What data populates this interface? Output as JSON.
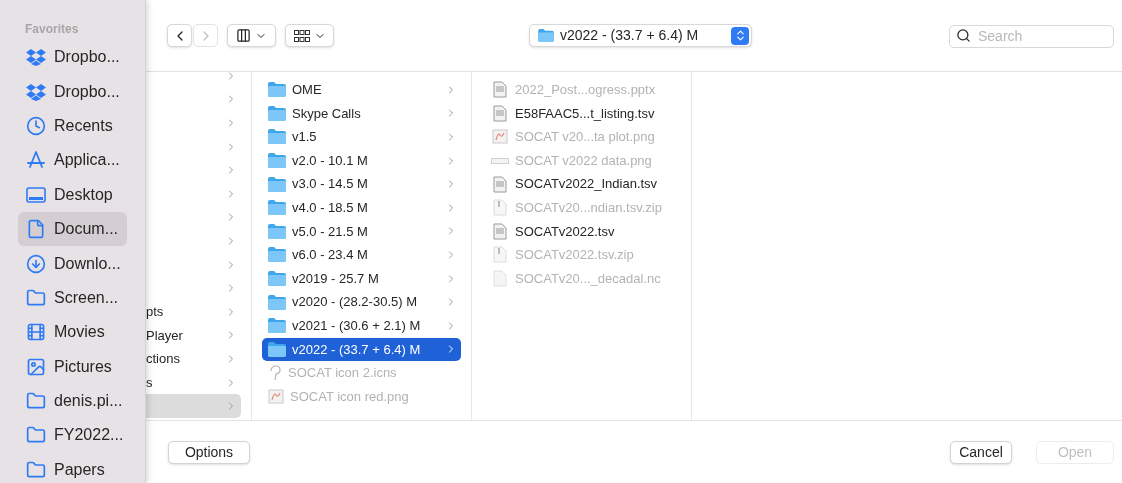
{
  "sidebar": {
    "heading": "Favorites",
    "items": [
      {
        "label": "Dropbo...",
        "kind": "dropbox",
        "selected": false
      },
      {
        "label": "Dropbo...",
        "kind": "dropbox",
        "selected": false
      },
      {
        "label": "Recents",
        "kind": "clock",
        "selected": false
      },
      {
        "label": "Applica...",
        "kind": "apps",
        "selected": false
      },
      {
        "label": "Desktop",
        "kind": "desktop",
        "selected": false
      },
      {
        "label": "Docum...",
        "kind": "document",
        "selected": true
      },
      {
        "label": "Downlo...",
        "kind": "download",
        "selected": false
      },
      {
        "label": "Screen...",
        "kind": "folder",
        "selected": false
      },
      {
        "label": "Movies",
        "kind": "film",
        "selected": false
      },
      {
        "label": "Pictures",
        "kind": "photo",
        "selected": false
      },
      {
        "label": "denis.pi...",
        "kind": "folder",
        "selected": false
      },
      {
        "label": "FY2022...",
        "kind": "folder",
        "selected": false
      },
      {
        "label": "Papers",
        "kind": "folder",
        "selected": false
      }
    ]
  },
  "toolbar": {
    "path": "v2022 - (33.7 + 6.4) M",
    "search": {
      "placeholder": "Search"
    }
  },
  "column_1": [
    {
      "selected": false
    },
    {
      "selected": false
    },
    {
      "selected": false
    },
    {
      "selected": false
    },
    {
      "selected": false
    },
    {
      "selected": false
    },
    {
      "selected": false
    },
    {
      "selected": false
    },
    {
      "selected": false
    },
    {
      "selected": false
    },
    {
      "label": "pts",
      "selected": false
    },
    {
      "label": "Player",
      "selected": false
    },
    {
      "label": "ctions",
      "selected": false
    },
    {
      "label": "s",
      "selected": false
    },
    {
      "selected": true
    }
  ],
  "column_2": [
    {
      "label": "OME",
      "kind": "folder",
      "selected": false,
      "disabled": false
    },
    {
      "label": "Skype Calls",
      "kind": "folder",
      "selected": false,
      "disabled": false
    },
    {
      "label": "v1.5",
      "kind": "folder",
      "selected": false,
      "disabled": false
    },
    {
      "label": "v2.0 - 10.1 M",
      "kind": "folder",
      "selected": false,
      "disabled": false
    },
    {
      "label": "v3.0 - 14.5 M",
      "kind": "folder",
      "selected": false,
      "disabled": false
    },
    {
      "label": "v4.0 - 18.5 M",
      "kind": "folder",
      "selected": false,
      "disabled": false
    },
    {
      "label": "v5.0 - 21.5 M",
      "kind": "folder",
      "selected": false,
      "disabled": false
    },
    {
      "label": "v6.0 - 23.4 M",
      "kind": "folder",
      "selected": false,
      "disabled": false
    },
    {
      "label": "v2019 - 25.7 M",
      "kind": "folder",
      "selected": false,
      "disabled": false
    },
    {
      "label": "v2020 - (28.2-30.5) M",
      "kind": "folder",
      "selected": false,
      "disabled": false
    },
    {
      "label": "v2021 - (30.6 + 2.1) M",
      "kind": "folder",
      "selected": false,
      "disabled": false
    },
    {
      "label": "v2022 - (33.7 + 6.4) M",
      "kind": "folder",
      "selected": true,
      "disabled": false
    },
    {
      "label": "SOCAT icon 2.icns",
      "kind": "icns",
      "selected": false,
      "disabled": true
    },
    {
      "label": "SOCAT icon red.png",
      "kind": "image",
      "selected": false,
      "disabled": true
    }
  ],
  "column_3": [
    {
      "label": "2022_Post...ogress.pptx",
      "kind": "document",
      "disabled": true
    },
    {
      "label": "E58FAAC5...t_listing.tsv",
      "kind": "document",
      "disabled": false
    },
    {
      "label": "SOCAT v20...ta plot.png",
      "kind": "image",
      "disabled": true
    },
    {
      "label": "SOCAT v2022 data.png",
      "kind": "strip",
      "disabled": true
    },
    {
      "label": "SOCATv2022_Indian.tsv",
      "kind": "document",
      "disabled": false
    },
    {
      "label": "SOCATv20...ndian.tsv.zip",
      "kind": "zip",
      "disabled": true
    },
    {
      "label": "SOCATv2022.tsv",
      "kind": "document",
      "disabled": false
    },
    {
      "label": "SOCATv2022.tsv.zip",
      "kind": "zip",
      "disabled": true
    },
    {
      "label": "SOCATv20..._decadal.nc",
      "kind": "plain",
      "disabled": true
    }
  ],
  "buttons": [
    {
      "label": "Options",
      "disabled": false
    },
    {
      "label": "Cancel",
      "disabled": false
    },
    {
      "label": "Open",
      "disabled": true
    }
  ]
}
